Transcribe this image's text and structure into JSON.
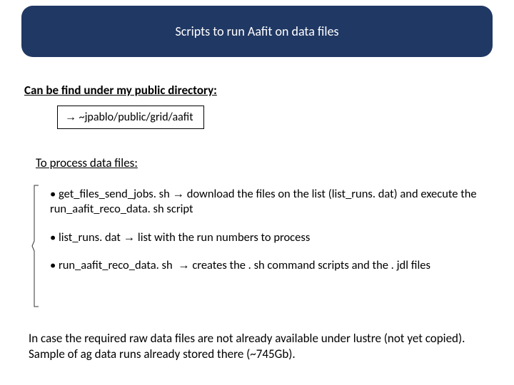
{
  "title": "Scripts to run Aafit on data files",
  "heading": "Can be find under my public directory:",
  "arrow": "→",
  "path": "~jpablo/public/grid/aafit",
  "section": "To process data files:",
  "items": [
    {
      "name": "get_files_send_jobs. sh",
      "desc": "download the files on the list (list_runs. dat) and execute the run_aafit_reco_data. sh script"
    },
    {
      "name": "list_runs. dat",
      "desc": "list with the run numbers to process"
    },
    {
      "name": "run_aafit_reco_data. sh",
      "desc": "creates the . sh command scripts and the . jdl files"
    }
  ],
  "footer": "In case the required raw data files are not already available under lustre (not yet copied). Sample of ag data runs already stored there (~745Gb)."
}
